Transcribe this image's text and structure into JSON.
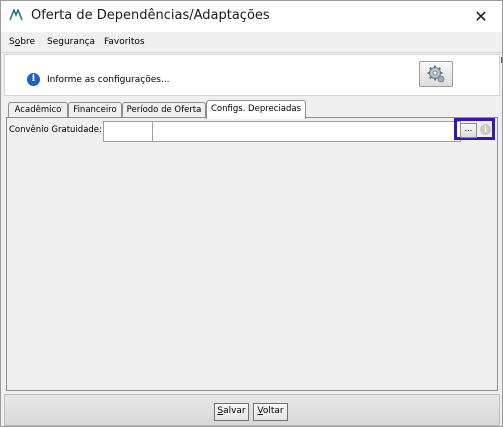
{
  "window": {
    "title": "Oferta de Dependências/Adaptações",
    "close_symbol": "✕"
  },
  "menu": {
    "items": [
      {
        "pre": "S",
        "ul": "o",
        "post": "bre"
      },
      {
        "pre": "",
        "ul": "",
        "post": "Segurança"
      },
      {
        "pre": "",
        "ul": "",
        "post": "Favoritos"
      }
    ]
  },
  "info": {
    "text": "Informe as configurações...",
    "icon": "info-icon",
    "icon_glyph": "i"
  },
  "tabs": [
    "Acadêmico",
    "Financeiro",
    "Período de Oferta",
    "Configs. Depreciadas"
  ],
  "active_tab": "Configs. Depreciadas",
  "form": {
    "field_label": "Convênio Gratuidade:",
    "code_value": "",
    "description_value": "",
    "lookup_label": "...",
    "info_glyph": "i"
  },
  "buttons": {
    "save": {
      "ul": "S",
      "rest": "alvar"
    },
    "back": {
      "ul": "V",
      "rest": "oltar"
    }
  },
  "colors": {
    "highlight": "#3b14b8",
    "info_icon": "#1b63c6",
    "app_icon": "#1a7c8c"
  }
}
